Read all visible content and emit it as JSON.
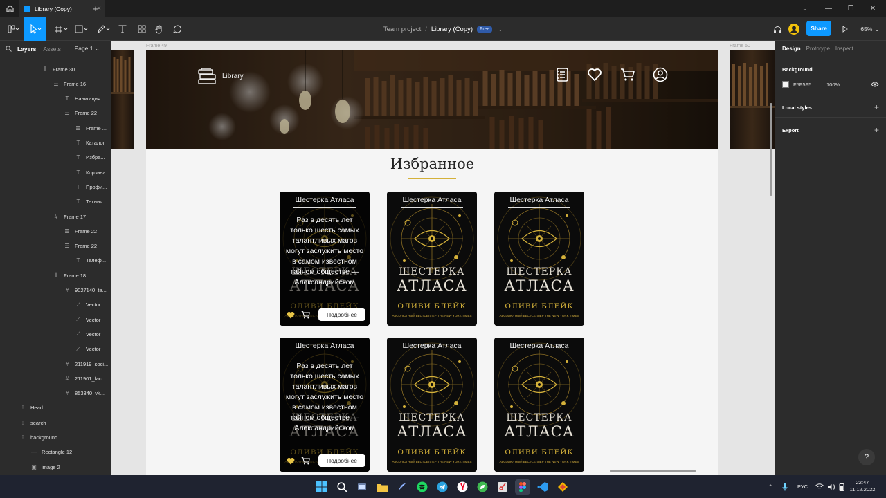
{
  "titlebar": {
    "tab_title": "Library (Copy)"
  },
  "toolbar": {
    "project": "Team project",
    "separator": "/",
    "file_name": "Library (Copy)",
    "plan_badge": "Free",
    "share_label": "Share",
    "zoom": "65%"
  },
  "left_panel": {
    "tabs": [
      "Layers",
      "Assets"
    ],
    "page": "Page 1",
    "layers": [
      {
        "label": "Frame 30",
        "icon": "autolayout-vertical-icon",
        "indent": 0
      },
      {
        "label": "Frame 16",
        "icon": "autolayout-horizontal-icon",
        "indent": 1
      },
      {
        "label": "Навигация",
        "icon": "text-icon",
        "indent": 2
      },
      {
        "label": "Frame 22",
        "icon": "autolayout-horizontal-icon",
        "indent": 2
      },
      {
        "label": "Frame ...",
        "icon": "autolayout-horizontal-icon",
        "indent": 3
      },
      {
        "label": "Каталог",
        "icon": "text-icon",
        "indent": 3
      },
      {
        "label": "Избра...",
        "icon": "text-icon",
        "indent": 3
      },
      {
        "label": "Корзина",
        "icon": "text-icon",
        "indent": 3
      },
      {
        "label": "Профи...",
        "icon": "text-icon",
        "indent": 3
      },
      {
        "label": "Технич...",
        "icon": "text-icon",
        "indent": 3
      },
      {
        "label": "Frame 17",
        "icon": "frame-icon",
        "indent": 1
      },
      {
        "label": "Frame 22",
        "icon": "autolayout-horizontal-icon",
        "indent": 2
      },
      {
        "label": "Frame 22",
        "icon": "autolayout-horizontal-icon",
        "indent": 2
      },
      {
        "label": "Телеф...",
        "icon": "text-icon",
        "indent": 3
      },
      {
        "label": "Frame 18",
        "icon": "autolayout-vertical-icon",
        "indent": 1
      },
      {
        "label": "9027140_te...",
        "icon": "frame-icon",
        "indent": 2
      },
      {
        "label": "Vector",
        "icon": "vector-icon",
        "indent": 3
      },
      {
        "label": "Vector",
        "icon": "vector-icon",
        "indent": 3
      },
      {
        "label": "Vector",
        "icon": "vector-icon",
        "indent": 3
      },
      {
        "label": "Vector",
        "icon": "vector-icon",
        "indent": 3
      },
      {
        "label": "211919_soci...",
        "icon": "frame-icon",
        "indent": 2
      },
      {
        "label": "211901_fac...",
        "icon": "frame-icon",
        "indent": 2
      },
      {
        "label": "853340_vk...",
        "icon": "frame-icon",
        "indent": 2
      },
      {
        "label": "Head",
        "icon": "component-dashed-icon",
        "indent": 0
      },
      {
        "label": "search",
        "icon": "component-dashed-icon",
        "indent": 0
      },
      {
        "label": "background",
        "icon": "component-dashed-icon",
        "indent": 0
      },
      {
        "label": "Rectangle 12",
        "icon": "rectangle-icon",
        "indent": 1
      },
      {
        "label": "image 2",
        "icon": "image-icon",
        "indent": 1
      }
    ]
  },
  "canvas": {
    "frame_left_label": "Frame 49",
    "frame_right_label": "Frame 50",
    "site": {
      "logo_text": "Library",
      "nav_icons": [
        "catalog-icon",
        "heart-icon",
        "cart-icon",
        "profile-icon"
      ],
      "section_title": "Избранное",
      "cards": [
        {
          "title": "Шестерка Атласа",
          "state": "hover",
          "description": "Раз в десять лет только шесть самых талантливых магов могут заслужить место в самом известном тайном обществе — Александрийском",
          "button": "Подробнее"
        },
        {
          "title": "Шестерка Атласа",
          "state": "cover"
        },
        {
          "title": "Шестерка Атласа",
          "state": "cover"
        },
        {
          "title": "Шестерка Атласа",
          "state": "hover",
          "description": "Раз в десять лет только шесть самых талантливых магов могут заслужить место в самом известном тайном обществе — Александрийском",
          "button": "Подробнее"
        },
        {
          "title": "Шестерка Атласа",
          "state": "cover"
        },
        {
          "title": "Шестерка Атласа",
          "state": "cover"
        }
      ],
      "cover": {
        "title_top": "ШЕСТЕРКА",
        "title_bottom": "АТЛАСА",
        "author": "ОЛИВИ БЛЕЙК",
        "tagline": "АБСОЛЮТНЫЙ БЕСТСЕЛЛЕР THE NEW YORK TIMES"
      },
      "accent_color": "#d4b13a"
    }
  },
  "right_panel": {
    "tabs": [
      "Design",
      "Prototype",
      "Inspect"
    ],
    "background_label": "Background",
    "background_hex": "F5F5F5",
    "background_opacity": "100%",
    "local_styles_label": "Local styles",
    "export_label": "Export"
  },
  "taskbar": {
    "lang": "РУС",
    "time": "22:47",
    "date": "11.12.2022"
  }
}
